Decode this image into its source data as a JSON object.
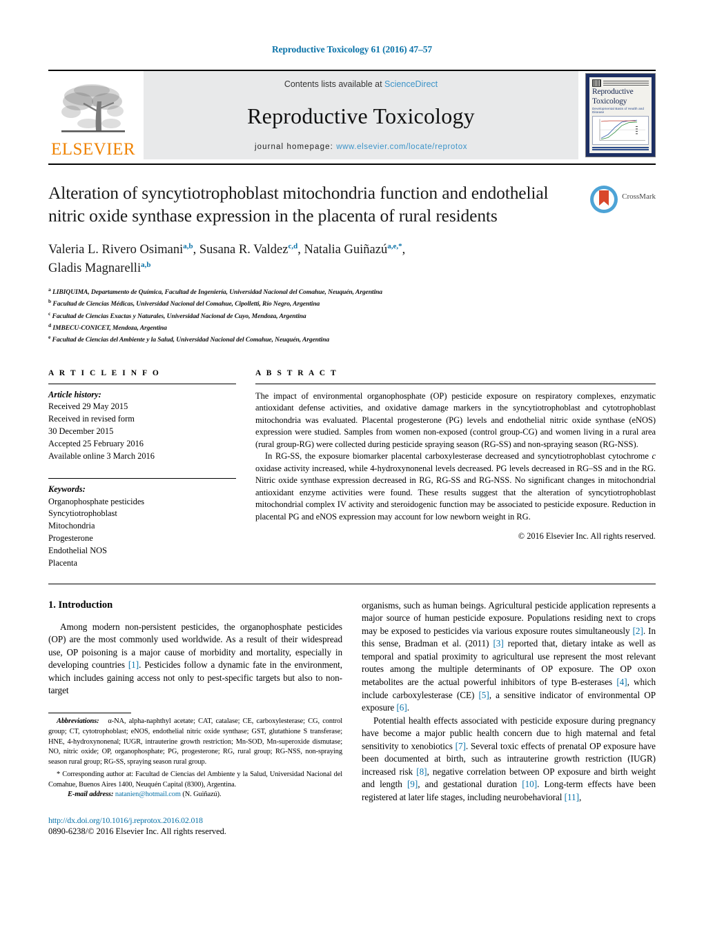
{
  "running_head": "Reproductive Toxicology 61 (2016) 47–57",
  "masthead": {
    "publisher_name": "ELSEVIER",
    "contents_prefix": "Contents lists available at ",
    "contents_link": "ScienceDirect",
    "journal_name": "Reproductive Toxicology",
    "homepage_prefix": "journal homepage: ",
    "homepage_url": "www.elsevier.com/locate/reprotox",
    "cover": {
      "title_line1": "Reproductive",
      "title_line2": "Toxicology",
      "subtitle": "Developmental Basis of Health and Disease"
    }
  },
  "article": {
    "title": "Alteration of syncytiotrophoblast mitochondria function and endothelial nitric oxide synthase expression in the placenta of rural residents",
    "crossmark_label": "CrossMark",
    "authors": [
      {
        "name": "Valeria L. Rivero Osimani",
        "marks": "a,b"
      },
      {
        "name": "Susana R. Valdez",
        "marks": "c,d"
      },
      {
        "name": "Natalia Guiñazú",
        "marks": "a,e,*"
      },
      {
        "name": "Gladis Magnarelli",
        "marks": "a,b"
      }
    ],
    "affiliations": [
      {
        "mark": "a",
        "text": "LIBIQUIMA, Departamento de Química, Facultad de Ingeniería, Universidad Nacional del Comahue, Neuquén, Argentina"
      },
      {
        "mark": "b",
        "text": "Facultad de Ciencias Médicas, Universidad Nacional del Comahue, Cipolletti, Río Negro, Argentina"
      },
      {
        "mark": "c",
        "text": "Facultad de Ciencias Exactas y Naturales, Universidad Nacional de Cuyo, Mendoza, Argentina"
      },
      {
        "mark": "d",
        "text": "IMBECU-CONICET, Mendoza, Argentina"
      },
      {
        "mark": "e",
        "text": "Facultad de Ciencias del Ambiente y la Salud, Universidad Nacional del Comahue, Neuquén, Argentina"
      }
    ]
  },
  "article_info": {
    "heading": "A R T I C L E    I N F O",
    "history_label": "Article history:",
    "history": [
      "Received 29 May 2015",
      "Received in revised form",
      "30 December 2015",
      "Accepted 25 February 2016",
      "Available online 3 March 2016"
    ],
    "keywords_label": "Keywords:",
    "keywords": [
      "Organophosphate pesticides",
      "Syncytiotrophoblast",
      "Mitochondria",
      "Progesterone",
      "Endothelial NOS",
      "Placenta"
    ]
  },
  "abstract": {
    "heading": "A B S T R A C T",
    "paragraphs": [
      "The impact of environmental organophosphate (OP) pesticide exposure on respiratory complexes, enzymatic antioxidant defense activities, and oxidative damage markers in the syncytiotrophoblast and cytotrophoblast mitochondria was evaluated. Placental progesterone (PG) levels and endothelial nitric oxide synthase (eNOS) expression were studied. Samples from women non-exposed (control group-CG) and women living in a rural area (rural group-RG) were collected during pesticide spraying season (RG-SS) and non-spraying season (RG-NSS).",
      "In RG-SS, the exposure biomarker placental carboxylesterase decreased and syncytiotrophoblast cytochrome c oxidase activity increased, while 4-hydroxynonenal levels decreased. PG levels decreased in RG–SS and in the RG. Nitric oxide synthase expression decreased in RG, RG-SS and RG-NSS. No significant changes in mitochondrial antioxidant enzyme activities were found. These results suggest that the alteration of syncytiotrophoblast mitochondrial complex IV activity and steroidogenic function may be associated to pesticide exposure. Reduction in placental PG and eNOS expression may account for low newborn weight in RG."
    ],
    "copyright": "© 2016 Elsevier Inc. All rights reserved."
  },
  "body": {
    "section_number_title": "1.  Introduction",
    "left_paragraph": "Among modern non-persistent pesticides, the organophosphate pesticides (OP) are the most commonly used worldwide. As a result of their widespread use, OP poisoning is a major cause of morbidity and mortality, especially in developing countries [1]. Pesticides follow a dynamic fate in the environment, which includes gaining access not only to pest-specific targets but also to non-target",
    "right_paragraph_1": "organisms, such as human beings. Agricultural pesticide application represents a major source of human pesticide exposure. Populations residing next to crops may be exposed to pesticides via various exposure routes simultaneously [2]. In this sense, Bradman et al. (2011) [3] reported that, dietary intake as well as temporal and spatial proximity to agricultural use represent the most relevant routes among the multiple determinants of OP exposure. The OP oxon metabolites are the actual powerful inhibitors of type B-esterases [4], which include carboxylesterase (CE) [5], a sensitive indicator of environmental OP exposure [6].",
    "right_paragraph_2": "Potential health effects associated with pesticide exposure during pregnancy have become a major public health concern due to high maternal and fetal sensitivity to xenobiotics [7]. Several toxic effects of prenatal OP exposure have been documented at birth, such as intrauterine growth restriction (IUGR) increased risk [8], negative correlation between OP exposure and birth weight and length [9], and gestational duration [10]. Long-term effects have been registered at later life stages, including neurobehavioral [11],"
  },
  "footnotes": {
    "abbrev_label": "Abbreviations:",
    "abbrev_text": "α-NA, alpha-naphthyl acetate; CAT, catalase; CE, carboxylesterase; CG, control group; CT, cytotrophoblast; eNOS, endothelial nitric oxide synthase; GST, glutathione S transferase; HNE, 4-hydroxynonenal; IUGR, intrauterine growth restriction; Mn-SOD, Mn-superoxide dismutase; NO, nitric oxide; OP, organophosphate; PG, progesterone; RG, rural group; RG-NSS, non-spraying season rural group; RG-SS, spraying season rural group.",
    "corresponding_text": "* Corresponding author at: Facultad de Ciencias del Ambiente y la Salud, Universidad Nacional del Comahue, Buenos Aires 1400, Neuquén Capital (8300), Argentina.",
    "email_label": "E-mail address:",
    "email": "natanien@hotmail.com",
    "email_suffix": "(N. Guiñazú)."
  },
  "footer": {
    "doi": "http://dx.doi.org/10.1016/j.reprotox.2016.02.018",
    "issn_line": "0890-6238/© 2016 Elsevier Inc. All rights reserved."
  },
  "colors": {
    "link_blue": "#0a72a8",
    "sciencedirect_blue": "#3b93c8",
    "elsevier_orange": "#ef8200",
    "cover_navy": "#1d2f63"
  }
}
